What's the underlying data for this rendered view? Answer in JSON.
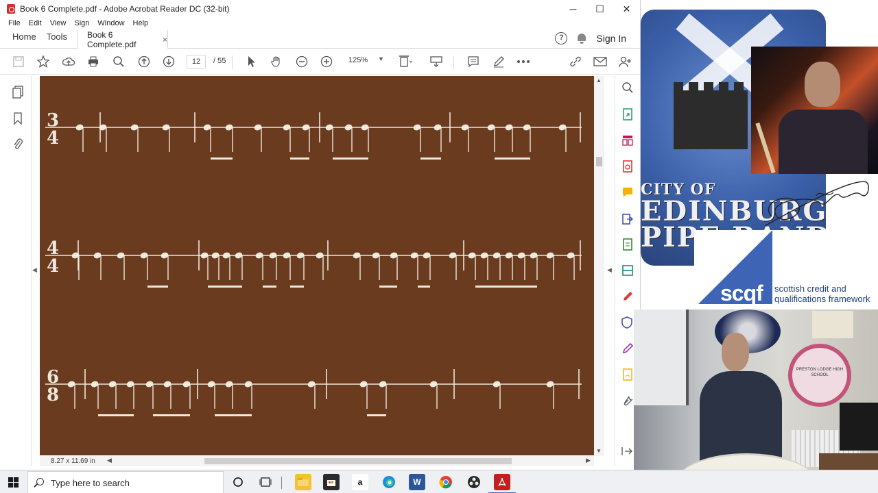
{
  "window": {
    "title": "Book 6 Complete.pdf - Adobe Acrobat Reader DC (32-bit)",
    "controls": {
      "minimize": "─",
      "maximize": "☐",
      "close": "✕"
    }
  },
  "menu": [
    "File",
    "Edit",
    "View",
    "Sign",
    "Window",
    "Help"
  ],
  "tabs": {
    "home": "Home",
    "tools": "Tools",
    "doc_tab": "Book 6 Complete.pdf",
    "doc_tab_close": "×",
    "sign_in": "Sign In",
    "help_glyph": "?"
  },
  "toolbar": {
    "current_page": "12",
    "page_total": "/ 55",
    "zoom": "125%",
    "icons": [
      "save-icon",
      "star-icon",
      "upload-icon",
      "print-icon",
      "search-icon",
      "prev-page-icon",
      "next-page-icon",
      "select-icon",
      "hand-icon",
      "zoom-out-icon",
      "zoom-in-icon",
      "fit-page-icon",
      "scroll-mode-icon",
      "comment-icon",
      "pen-icon",
      "more-icon",
      "link-icon",
      "email-icon",
      "share-user-icon"
    ]
  },
  "status": {
    "page_size": "8.27 x 11.69 in"
  },
  "score": {
    "staves": [
      {
        "time_top": "3",
        "time_bottom": "4"
      },
      {
        "time_top": "4",
        "time_bottom": "4"
      },
      {
        "time_top": "6",
        "time_bottom": "8"
      }
    ]
  },
  "overlay": {
    "band_line1": "CITY OF",
    "band_line2": "EDINBURGH",
    "band_line3": "PIPE BAND",
    "scqf_word": "scqf",
    "scqf_caption_1": "scottish credit and",
    "scqf_caption_2": "qualifications framework",
    "webcam_sign": "PRESTON LODGE HIGH SCHOOL"
  },
  "taskbar": {
    "search_placeholder": "Type here to search",
    "apps": [
      "cortana-icon",
      "task-view-icon",
      "file-explorer-icon",
      "store-icon",
      "amazon-icon",
      "edge-icon",
      "word-icon",
      "chrome-icon",
      "obs-icon",
      "acrobat-icon"
    ]
  },
  "colors": {
    "page_bg": "#6b3b1f",
    "accent": "#3d64b5",
    "acrobat_red": "#d32f2f"
  }
}
